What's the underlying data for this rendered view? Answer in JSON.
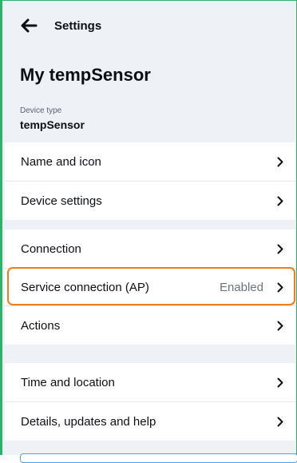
{
  "header": {
    "title": "Settings",
    "back_icon": "arrow-left-icon"
  },
  "device": {
    "title": "My tempSensor",
    "type_label": "Device type",
    "type_value": "tempSensor"
  },
  "rows": [
    {
      "label": "Name and icon"
    },
    {
      "label": "Device settings"
    },
    {
      "label": "Connection"
    },
    {
      "label": "Service connection (AP)",
      "value": "Enabled",
      "highlighted": true
    },
    {
      "label": "Actions"
    },
    {
      "label": "Time and location"
    },
    {
      "label": "Details, updates and help"
    }
  ],
  "colors": {
    "frame_accent": "#2fb36b",
    "highlight": "#f07d1b",
    "background": "#eef1f6"
  }
}
